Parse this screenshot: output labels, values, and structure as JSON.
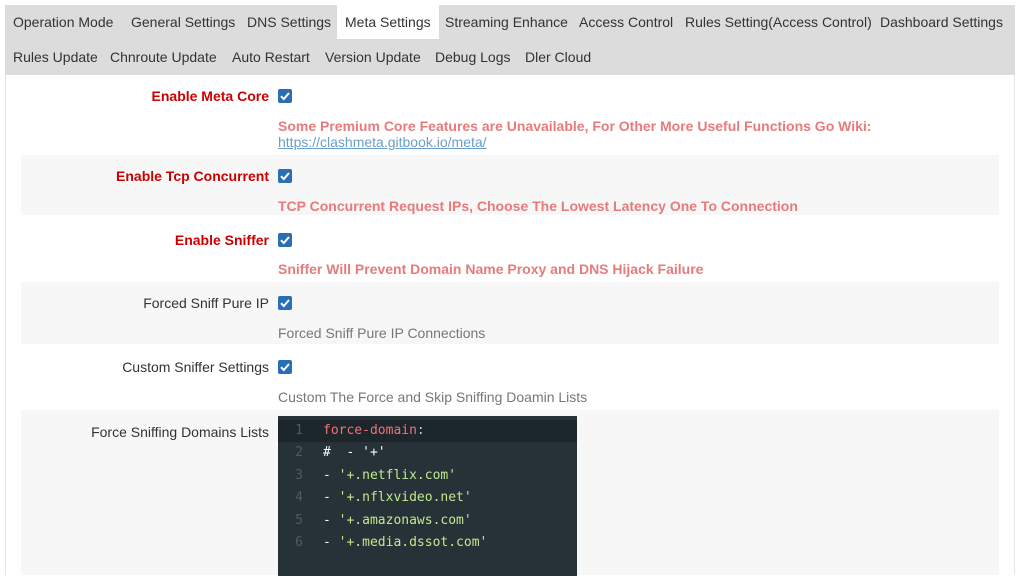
{
  "tabs": [
    {
      "label": "Operation Mode",
      "active": false
    },
    {
      "label": "General Settings",
      "active": false
    },
    {
      "label": "DNS Settings",
      "active": false
    },
    {
      "label": "Meta Settings",
      "active": true
    },
    {
      "label": "Streaming Enhance",
      "active": false
    },
    {
      "label": "Access Control",
      "active": false
    },
    {
      "label": "Rules Setting(Access Control)",
      "active": false
    },
    {
      "label": "Dashboard Settings",
      "active": false
    },
    {
      "label": "Rules Update",
      "active": false
    },
    {
      "label": "Chnroute Update",
      "active": false
    },
    {
      "label": "Auto Restart",
      "active": false
    },
    {
      "label": "Version Update",
      "active": false
    },
    {
      "label": "Debug Logs",
      "active": false
    },
    {
      "label": "Dler Cloud",
      "active": false
    }
  ],
  "settings": {
    "meta_core": {
      "label": "Enable Meta Core",
      "checked": true,
      "desc": "Some Premium Core Features are Unavailable, For Other More Useful Functions Go Wiki:",
      "link": "https://clashmeta.gitbook.io/meta/"
    },
    "tcp_concurrent": {
      "label": "Enable Tcp Concurrent",
      "checked": true,
      "desc": "TCP Concurrent Request IPs, Choose The Lowest Latency One To Connection"
    },
    "sniffer": {
      "label": "Enable Sniffer",
      "checked": true,
      "desc": "Sniffer Will Prevent Domain Name Proxy and DNS Hijack Failure"
    },
    "forced_sniff_pure_ip": {
      "label": "Forced Sniff Pure IP",
      "checked": true,
      "desc": "Forced Sniff Pure IP Connections"
    },
    "custom_sniffer": {
      "label": "Custom Sniffer Settings",
      "checked": true,
      "desc": "Custom The Force and Skip Sniffing Doamin Lists"
    },
    "force_sniffing_domains": {
      "label": "Force Sniffing Domains Lists"
    }
  },
  "editor": {
    "line_numbers": [
      "1",
      "2",
      "3",
      "4",
      "5",
      "6"
    ],
    "key": "force-domain",
    "colon": ":",
    "comment_line": "#  - '+'",
    "dash": "- ",
    "values": [
      "'+.netflix.com'",
      "'+.nflxvideo.net'",
      "'+.amazonaws.com'",
      "'+.media.dssot.com'"
    ]
  },
  "colors": {
    "required_label": "#cc0000",
    "warning_text": "#e77b7b",
    "link": "#6a9fc9",
    "checkbox": "#2a6fb6",
    "tabbar_bg": "#dcdcdc",
    "editor_bg": "#263238"
  }
}
